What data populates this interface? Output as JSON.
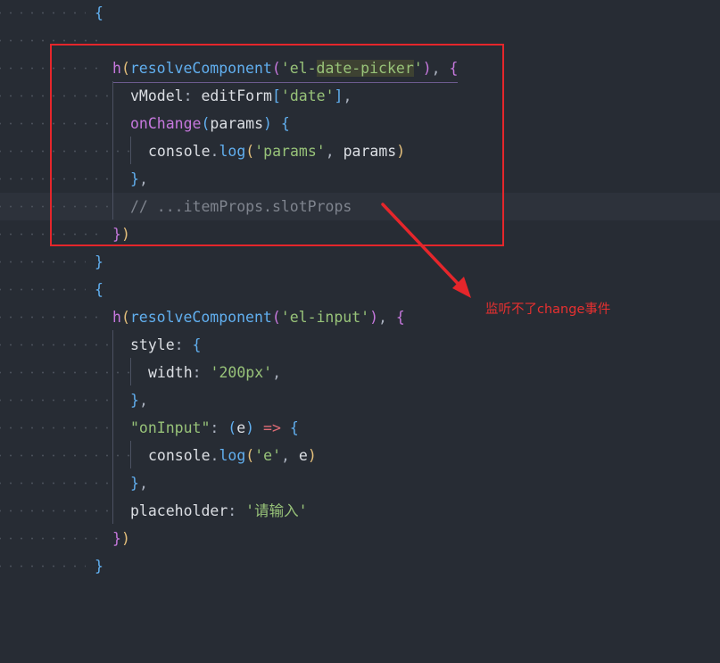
{
  "editor": {
    "lines": [
      {
        "l1": "{"
      },
      {},
      {
        "f": "h",
        "p1": "(",
        "c": "resolveComponent",
        "p2": "(",
        "s1": "'el-",
        "s2": "date-picker",
        "s3": "'",
        "p3": ")",
        "p4": ",",
        "b": "{"
      },
      {
        "k": "vModel",
        "p1": ":",
        "c": "editForm",
        "p2": "[",
        "s": "'date'",
        "p3": "]",
        "p4": ","
      },
      {
        "c": "onChange",
        "p1": "(",
        "k": "params",
        "p2": ")",
        "b": "{"
      },
      {
        "c1": "console",
        "p1": ".",
        "c2": "log",
        "p2": "(",
        "s": "'params'",
        "p3": ",",
        "k": "params",
        "p4": ")"
      },
      {
        "b": "}",
        "p": ","
      },
      {
        "cm": "// ...itemProps.slotProps"
      },
      {
        "b": "}",
        "p": ")"
      },
      {
        "l1": "}"
      },
      {
        "l1": "{"
      },
      {
        "f": "h",
        "p1": "(",
        "c": "resolveComponent",
        "p2": "(",
        "s": "'el-input'",
        "p3": ")",
        "p4": ",",
        "b": "{"
      },
      {
        "k": "style",
        "p1": ":",
        "b": "{"
      },
      {
        "k": "width",
        "p1": ":",
        "s": "'200px'",
        "p2": ","
      },
      {
        "b": "}",
        "p": ","
      },
      {
        "s": "\"onInput\"",
        "p1": ":",
        "p2": "(",
        "k": "e",
        "p3": ")",
        "op": "=>",
        "b": "{"
      },
      {
        "c1": "console",
        "p1": ".",
        "c2": "log",
        "p2": "(",
        "s": "'e'",
        "p3": ",",
        "k": "e",
        "p4": ")"
      },
      {
        "b": "}",
        "p": ","
      },
      {
        "k": "placeholder",
        "p1": ":",
        "s": "'请输入'"
      },
      {
        "b": "}",
        "p": ")"
      },
      {
        "l1": "}"
      }
    ]
  },
  "annotation": {
    "text": "监听不了change事件",
    "color": "#e83030"
  },
  "box_color": "#e5262b"
}
